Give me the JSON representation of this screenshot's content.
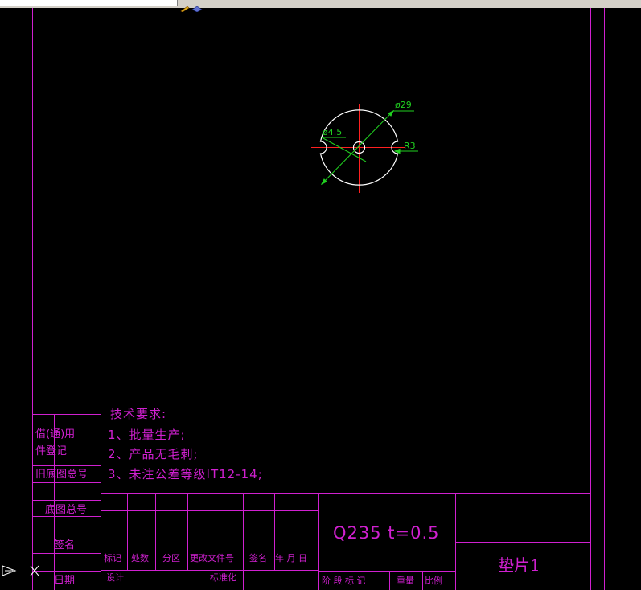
{
  "drawing": {
    "dimensions": {
      "outer_diameter": "ø29",
      "hole": "ø4.5",
      "notch_radius": "R3"
    },
    "tech_requirements": {
      "title": "技术要求:",
      "items": [
        "1、批量生产;",
        "2、产品无毛刺;",
        "3、未注公差等级IT12-14;"
      ]
    },
    "side_labels": {
      "borrow": "借(通)用",
      "register": "件登记",
      "old_no": "旧底图总号",
      "base_no": "底图总号",
      "sign": "签名",
      "date": "日期"
    },
    "title_block": {
      "headers": [
        "标记",
        "处数",
        "分区",
        "更改文件号",
        "签名",
        "年 月 日"
      ],
      "row2": {
        "design": "设计",
        "standardize": "标准化"
      },
      "material": "Q235  t=0.5",
      "part_name": "垫片1",
      "stage_row": {
        "stage": "阶 段 标 记",
        "weight": "重量",
        "scale": "比例"
      }
    }
  },
  "colors": {
    "frame": "#d020d0",
    "geometry": "#ffffff",
    "centerline": "#ff2020",
    "dimension": "#20d020",
    "background": "#000000"
  }
}
